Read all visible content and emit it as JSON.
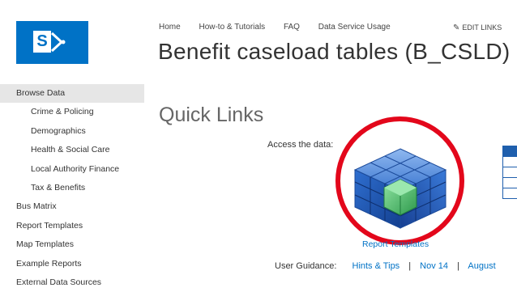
{
  "brand": {
    "logo_letter": "S"
  },
  "topnav": {
    "items": [
      "Home",
      "How-to & Tutorials",
      "FAQ",
      "Data Service Usage"
    ],
    "edit_links": "EDIT LINKS"
  },
  "site_title": "Benefit caseload tables (B_CSLD)",
  "leftnav": {
    "items": [
      {
        "label": "Browse Data",
        "level": 0,
        "selected": true
      },
      {
        "label": "Crime & Policing",
        "level": 1
      },
      {
        "label": "Demographics",
        "level": 1
      },
      {
        "label": "Health & Social Care",
        "level": 1
      },
      {
        "label": "Local Authority Finance",
        "level": 1
      },
      {
        "label": "Tax & Benefits",
        "level": 1
      },
      {
        "label": "Bus Matrix",
        "level": 0
      },
      {
        "label": "Report Templates",
        "level": 0
      },
      {
        "label": "Map Templates",
        "level": 0
      },
      {
        "label": "Example Reports",
        "level": 0
      },
      {
        "label": "External Data Sources",
        "level": 0
      }
    ]
  },
  "main": {
    "heading": "Quick Links",
    "access_label": "Access the data:",
    "cube_link": "Report Templates",
    "guidance_label": "User Guidance:",
    "guidance_links": [
      "Hints & Tips",
      "Nov 14",
      "August"
    ],
    "separator": "|"
  },
  "colors": {
    "brand_blue": "#0072c6",
    "highlight_ring": "#e3071b",
    "cube_blue": "#1f5fad",
    "cube_green": "#3fae5a"
  }
}
